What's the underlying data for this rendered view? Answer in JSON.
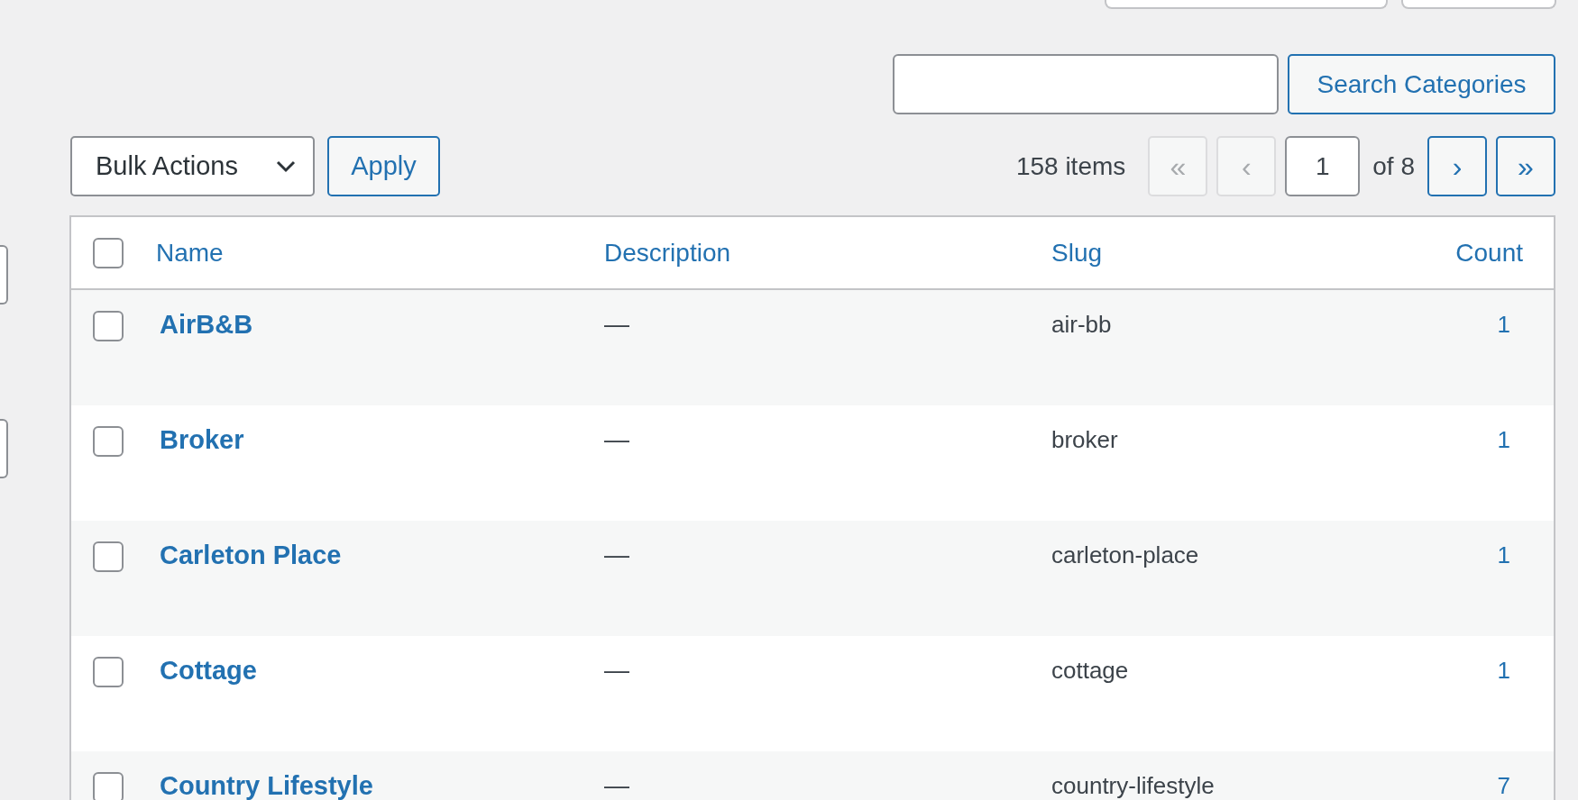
{
  "search": {
    "button": "Search Categories"
  },
  "bulk_actions": {
    "label": "Bulk Actions",
    "apply": "Apply"
  },
  "pagination": {
    "items": "158 items",
    "first": "«",
    "prev": "‹",
    "page": "1",
    "of": "of 8",
    "next": "›",
    "last": "»",
    "first_disabled": true,
    "prev_disabled": true,
    "next_disabled": false,
    "last_disabled": false
  },
  "table": {
    "select_all": false,
    "columns": [
      "Name",
      "Description",
      "Slug",
      "Count"
    ],
    "rows": [
      {
        "name": "AirB&B",
        "description": "—",
        "slug": "air-bb",
        "count": "1",
        "checked": false
      },
      {
        "name": "Broker",
        "description": "—",
        "slug": "broker",
        "count": "1",
        "checked": false
      },
      {
        "name": "Carleton Place",
        "description": "—",
        "slug": "carleton-place",
        "count": "1",
        "checked": false
      },
      {
        "name": "Cottage",
        "description": "—",
        "slug": "cottage",
        "count": "1",
        "checked": false
      },
      {
        "name": "Country Lifestyle",
        "description": "—",
        "slug": "country-lifestyle",
        "count": "7",
        "checked": false
      }
    ]
  }
}
